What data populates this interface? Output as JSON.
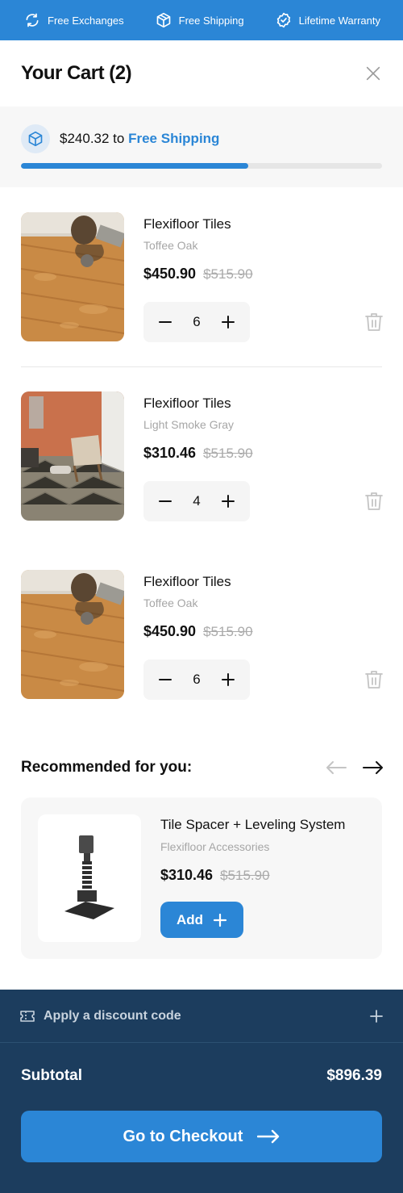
{
  "topbar": {
    "perks": [
      {
        "label": "Free Exchanges",
        "icon": "refresh-icon"
      },
      {
        "label": "Free Shipping",
        "icon": "box-icon"
      },
      {
        "label": "Lifetime Warranty",
        "icon": "badge-check-icon"
      }
    ]
  },
  "cart": {
    "title": "Your Cart (2)",
    "shipping": {
      "amount": "$240.32 to",
      "goal": "Free Shipping",
      "progress": 0.63
    },
    "items": [
      {
        "name": "Flexifloor Tiles",
        "variant": "Toffee Oak",
        "price": "$450.90",
        "old_price": "$515.90",
        "qty": "6"
      },
      {
        "name": "Flexifloor Tiles",
        "variant": "Light Smoke Gray",
        "price": "$310.46",
        "old_price": "$515.90",
        "qty": "4"
      },
      {
        "name": "Flexifloor Tiles",
        "variant": "Toffee Oak",
        "price": "$450.90",
        "old_price": "$515.90",
        "qty": "6"
      }
    ]
  },
  "recommended": {
    "title": "Recommended for you:",
    "product": {
      "name": "Tile Spacer + Leveling System",
      "variant": "Flexifloor Accessories",
      "price": "$310.46",
      "old_price": "$515.90",
      "add_label": "Add"
    }
  },
  "footer": {
    "discount_label": "Apply a discount code",
    "subtotal_label": "Subtotal",
    "subtotal_value": "$896.39",
    "checkout_label": "Go to Checkout"
  },
  "colors": {
    "accent": "#2b86d6",
    "footer_bg": "#1c3d5e"
  }
}
